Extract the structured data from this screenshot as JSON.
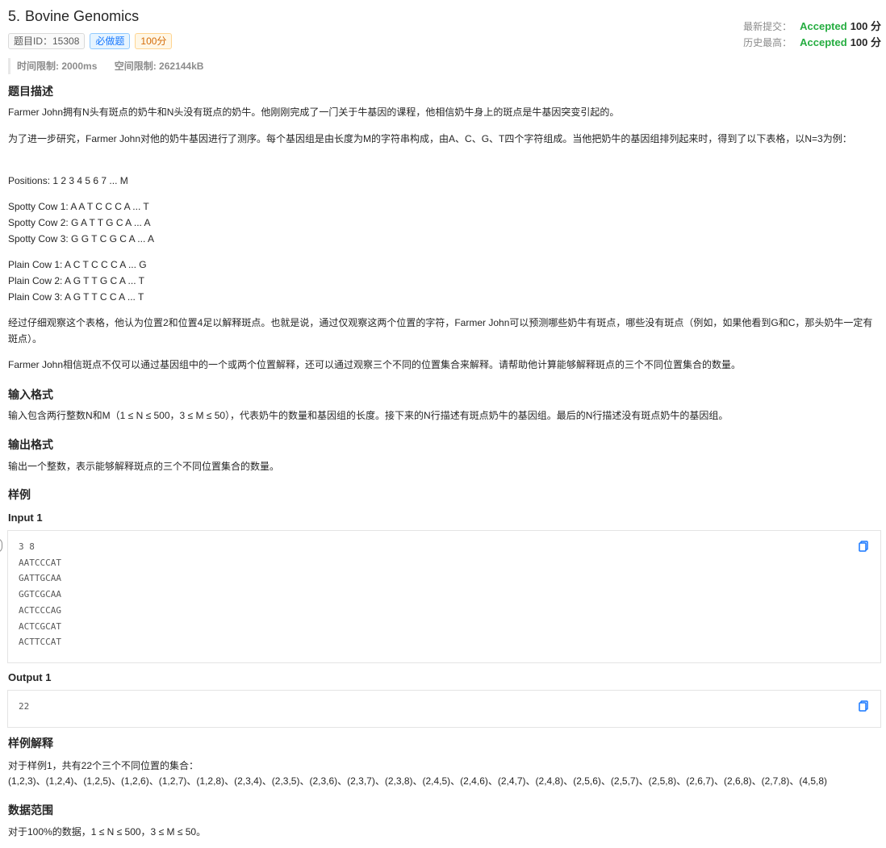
{
  "header": {
    "number": "5.",
    "title": "Bovine Genomics",
    "tags": {
      "problem_id": "题目ID：15308",
      "required": "必做题",
      "score": "100分"
    }
  },
  "status": {
    "latest_label": "最新提交：",
    "latest_result": "Accepted",
    "latest_score": "100 分",
    "best_label": "历史最高：",
    "best_result": "Accepted",
    "best_score": "100 分"
  },
  "limits": {
    "time": "时间限制: 2000ms",
    "memory": "空间限制: 262144kB"
  },
  "description": {
    "heading": "题目描述",
    "p1": "Farmer John拥有N头有斑点的奶牛和N头没有斑点的奶牛。他刚刚完成了一门关于牛基因的课程，他相信奶牛身上的斑点是牛基因突变引起的。",
    "p2": "为了进一步研究，Farmer John对他的奶牛基因进行了测序。每个基因组是由长度为M的字符串构成，由A、C、G、T四个字符组成。当他把奶牛的基因组排列起来时，得到了以下表格，以N=3为例：",
    "positions": "Positions: 1 2 3 4 5 6 7 ... M",
    "spotty": [
      "Spotty Cow 1: A A T C C C A ... T",
      "Spotty Cow 2: G A T T G C A ... A",
      "Spotty Cow 3: G G T C G C A ... A"
    ],
    "plain": [
      "Plain Cow 1: A C T C C C A ... G",
      "Plain Cow 2: A G T T G C A ... T",
      "Plain Cow 3: A G T T C C A ... T"
    ],
    "p3": "经过仔细观察这个表格，他认为位置2和位置4足以解释斑点。也就是说，通过仅观察这两个位置的字符，Farmer John可以预测哪些奶牛有斑点，哪些没有斑点（例如，如果他看到G和C，那头奶牛一定有斑点）。",
    "p4": "Farmer John相信斑点不仅可以通过基因组中的一个或两个位置解释，还可以通过观察三个不同的位置集合来解释。请帮助他计算能够解释斑点的三个不同位置集合的数量。"
  },
  "input_format": {
    "heading": "输入格式",
    "text": "输入包含两行整数N和M（1 ≤ N ≤ 500，3 ≤ M ≤ 50），代表奶牛的数量和基因组的长度。接下来的N行描述有斑点奶牛的基因组。最后的N行描述没有斑点奶牛的基因组。"
  },
  "output_format": {
    "heading": "输出格式",
    "text": "输出一个整数，表示能够解释斑点的三个不同位置集合的数量。"
  },
  "samples": {
    "heading": "样例",
    "input_label": "Input 1",
    "input_text": "3 8\nAATCCCAT\nGATTGCAA\nGGTCGCAA\nACTCCCAG\nACTCGCAT\nACTTCCAT",
    "output_label": "Output 1",
    "output_text": "22"
  },
  "explanation": {
    "heading": "样例解释",
    "line1": "对于样例1，共有22个三个不同位置的集合：",
    "line2": "(1,2,3)、(1,2,4)、(1,2,5)、(1,2,6)、(1,2,7)、(1,2,8)、(2,3,4)、(2,3,5)、(2,3,6)、(2,3,7)、(2,3,8)、(2,4,5)、(2,4,6)、(2,4,7)、(2,4,8)、(2,5,6)、(2,5,7)、(2,5,8)、(2,6,7)、(2,6,8)、(2,7,8)、(4,5,8)"
  },
  "constraints": {
    "heading": "数据范围",
    "text": "对于100%的数据，1 ≤ N ≤ 500，3 ≤ M ≤ 50。"
  },
  "colors": {
    "accepted": "#25ad40",
    "copy_icon": "#1677ff"
  },
  "icons": {
    "copy": "copy-icon"
  }
}
